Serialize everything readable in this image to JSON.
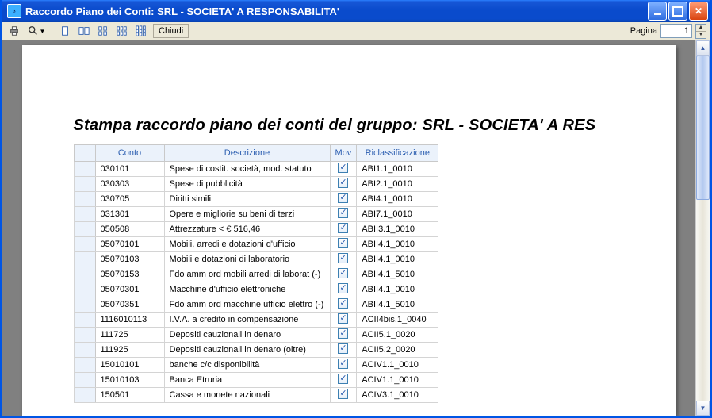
{
  "window": {
    "title": "Raccordo Piano dei Conti: SRL - SOCIETA' A RESPONSABILITA'"
  },
  "toolbar": {
    "close_label": "Chiudi",
    "pagina_label": "Pagina",
    "page_value": "1"
  },
  "report": {
    "title": "Stampa raccordo piano dei conti del gruppo: SRL - SOCIETA' A RES",
    "headers": {
      "conto": "Conto",
      "descrizione": "Descrizione",
      "mov": "Mov",
      "riclass": "Riclassificazione"
    },
    "rows": [
      {
        "conto": "030101",
        "descr": "Spese di costit. società, mod. statuto",
        "mov": true,
        "ricl": "ABI1.1_0010"
      },
      {
        "conto": "030303",
        "descr": "Spese di pubblicità",
        "mov": true,
        "ricl": "ABI2.1_0010"
      },
      {
        "conto": "030705",
        "descr": "Diritti simili",
        "mov": true,
        "ricl": "ABI4.1_0010"
      },
      {
        "conto": "031301",
        "descr": "Opere e migliorie su beni di terzi",
        "mov": true,
        "ricl": "ABI7.1_0010"
      },
      {
        "conto": "050508",
        "descr": "Attrezzature < € 516,46",
        "mov": true,
        "ricl": "ABII3.1_0010"
      },
      {
        "conto": "05070101",
        "descr": "Mobili, arredi e dotazioni d'ufficio",
        "mov": true,
        "ricl": "ABII4.1_0010"
      },
      {
        "conto": "05070103",
        "descr": "Mobili e dotazioni di laboratorio",
        "mov": true,
        "ricl": "ABII4.1_0010"
      },
      {
        "conto": "05070153",
        "descr": "Fdo amm ord mobili arredi di laborat (-)",
        "mov": true,
        "ricl": "ABII4.1_5010"
      },
      {
        "conto": "05070301",
        "descr": "Macchine d'ufficio elettroniche",
        "mov": true,
        "ricl": "ABII4.1_0010"
      },
      {
        "conto": "05070351",
        "descr": "Fdo amm ord macchine ufficio elettro (-)",
        "mov": true,
        "ricl": "ABII4.1_5010"
      },
      {
        "conto": "1116010113",
        "descr": "I.V.A. a credito in compensazione",
        "mov": true,
        "ricl": "ACII4bis.1_0040"
      },
      {
        "conto": "111725",
        "descr": "Depositi cauzionali in denaro",
        "mov": true,
        "ricl": "ACII5.1_0020"
      },
      {
        "conto": "111925",
        "descr": "Depositi cauzionali in denaro (oltre)",
        "mov": true,
        "ricl": "ACII5.2_0020"
      },
      {
        "conto": "15010101",
        "descr": "banche c/c disponibilità",
        "mov": true,
        "ricl": "ACIV1.1_0010"
      },
      {
        "conto": "15010103",
        "descr": "Banca Etruria",
        "mov": true,
        "ricl": "ACIV1.1_0010"
      },
      {
        "conto": "150501",
        "descr": "Cassa e monete nazionali",
        "mov": true,
        "ricl": "ACIV3.1_0010"
      }
    ]
  }
}
